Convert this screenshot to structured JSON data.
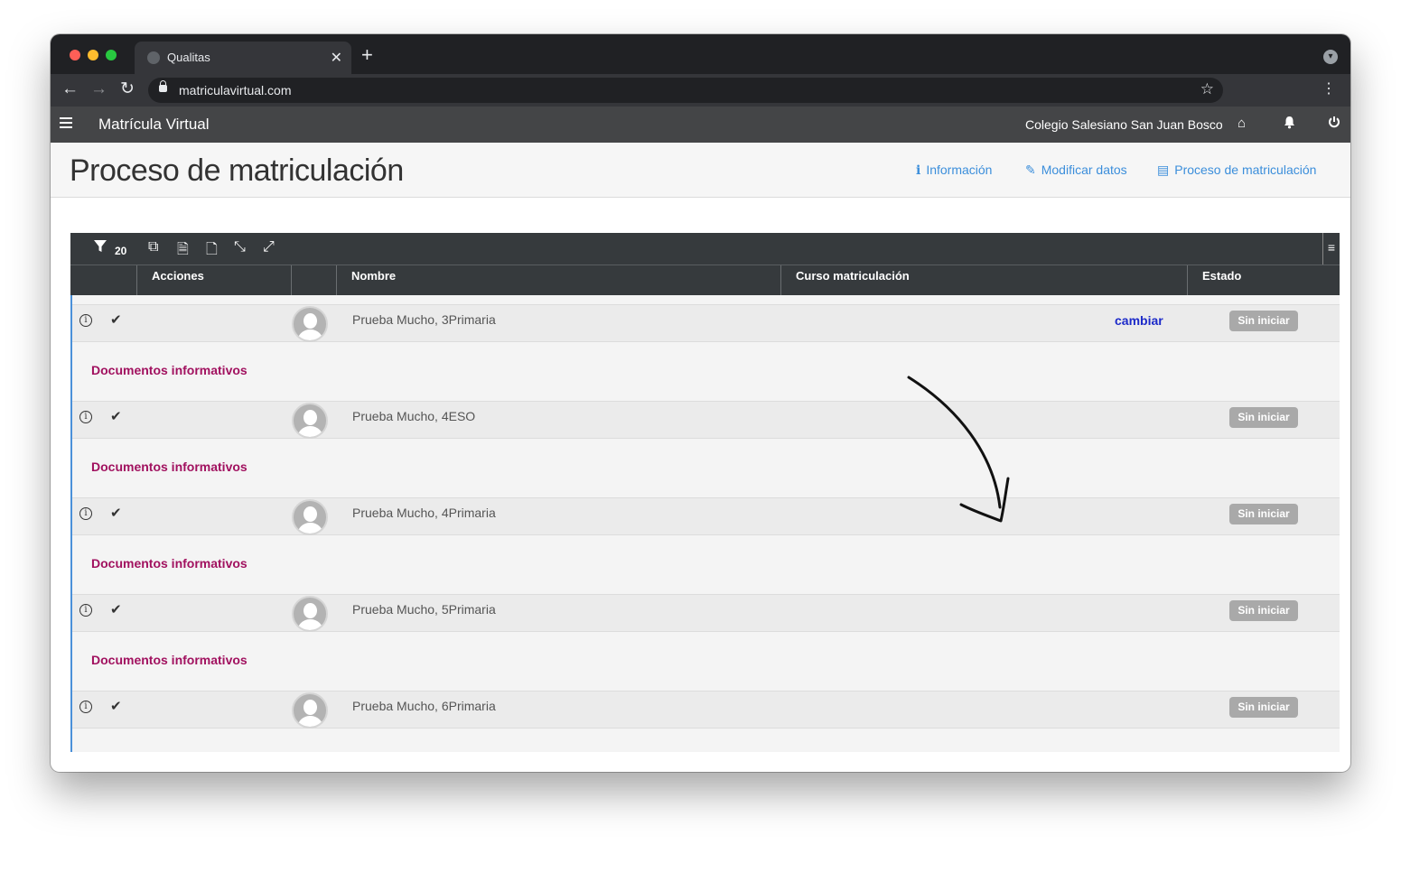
{
  "browser": {
    "tab_title": "Qualitas",
    "new_tab": "+",
    "close": "✕",
    "url": "matriculavirtual.com"
  },
  "app": {
    "title": "Matrícula Virtual",
    "school": "Colegio Salesiano San Juan Bosco"
  },
  "page": {
    "title": "Proceso de matriculación",
    "links": [
      {
        "label": "Información",
        "icon": "info-icon"
      },
      {
        "label": "Modificar datos",
        "icon": "edit-icon"
      },
      {
        "label": "Proceso de matriculación",
        "icon": "card-icon"
      }
    ]
  },
  "grid": {
    "filter_count": "20",
    "columns": [
      "Acciones",
      "Nombre",
      "Curso matriculación",
      "Estado"
    ],
    "rows": [
      {
        "name": "Prueba Mucho, 3Primaria",
        "action": "cambiar",
        "status": "Sin iniciar",
        "docs": "Documentos informativos"
      },
      {
        "name": "Prueba Mucho, 4ESO",
        "status": "Sin iniciar",
        "docs": "Documentos informativos"
      },
      {
        "name": "Prueba Mucho, 4Primaria",
        "status": "Sin iniciar",
        "docs": "Documentos informativos"
      },
      {
        "name": "Prueba Mucho, 5Primaria",
        "status": "Sin iniciar",
        "docs": "Documentos informativos"
      },
      {
        "name": "Prueba Mucho, 6Primaria",
        "status": "Sin iniciar"
      }
    ]
  },
  "colors": {
    "link_blue": "#3b8edb",
    "docs_magenta": "#a1115f",
    "cambiar_blue": "#1c2ac9",
    "badge_gray": "#a9a9a9"
  }
}
